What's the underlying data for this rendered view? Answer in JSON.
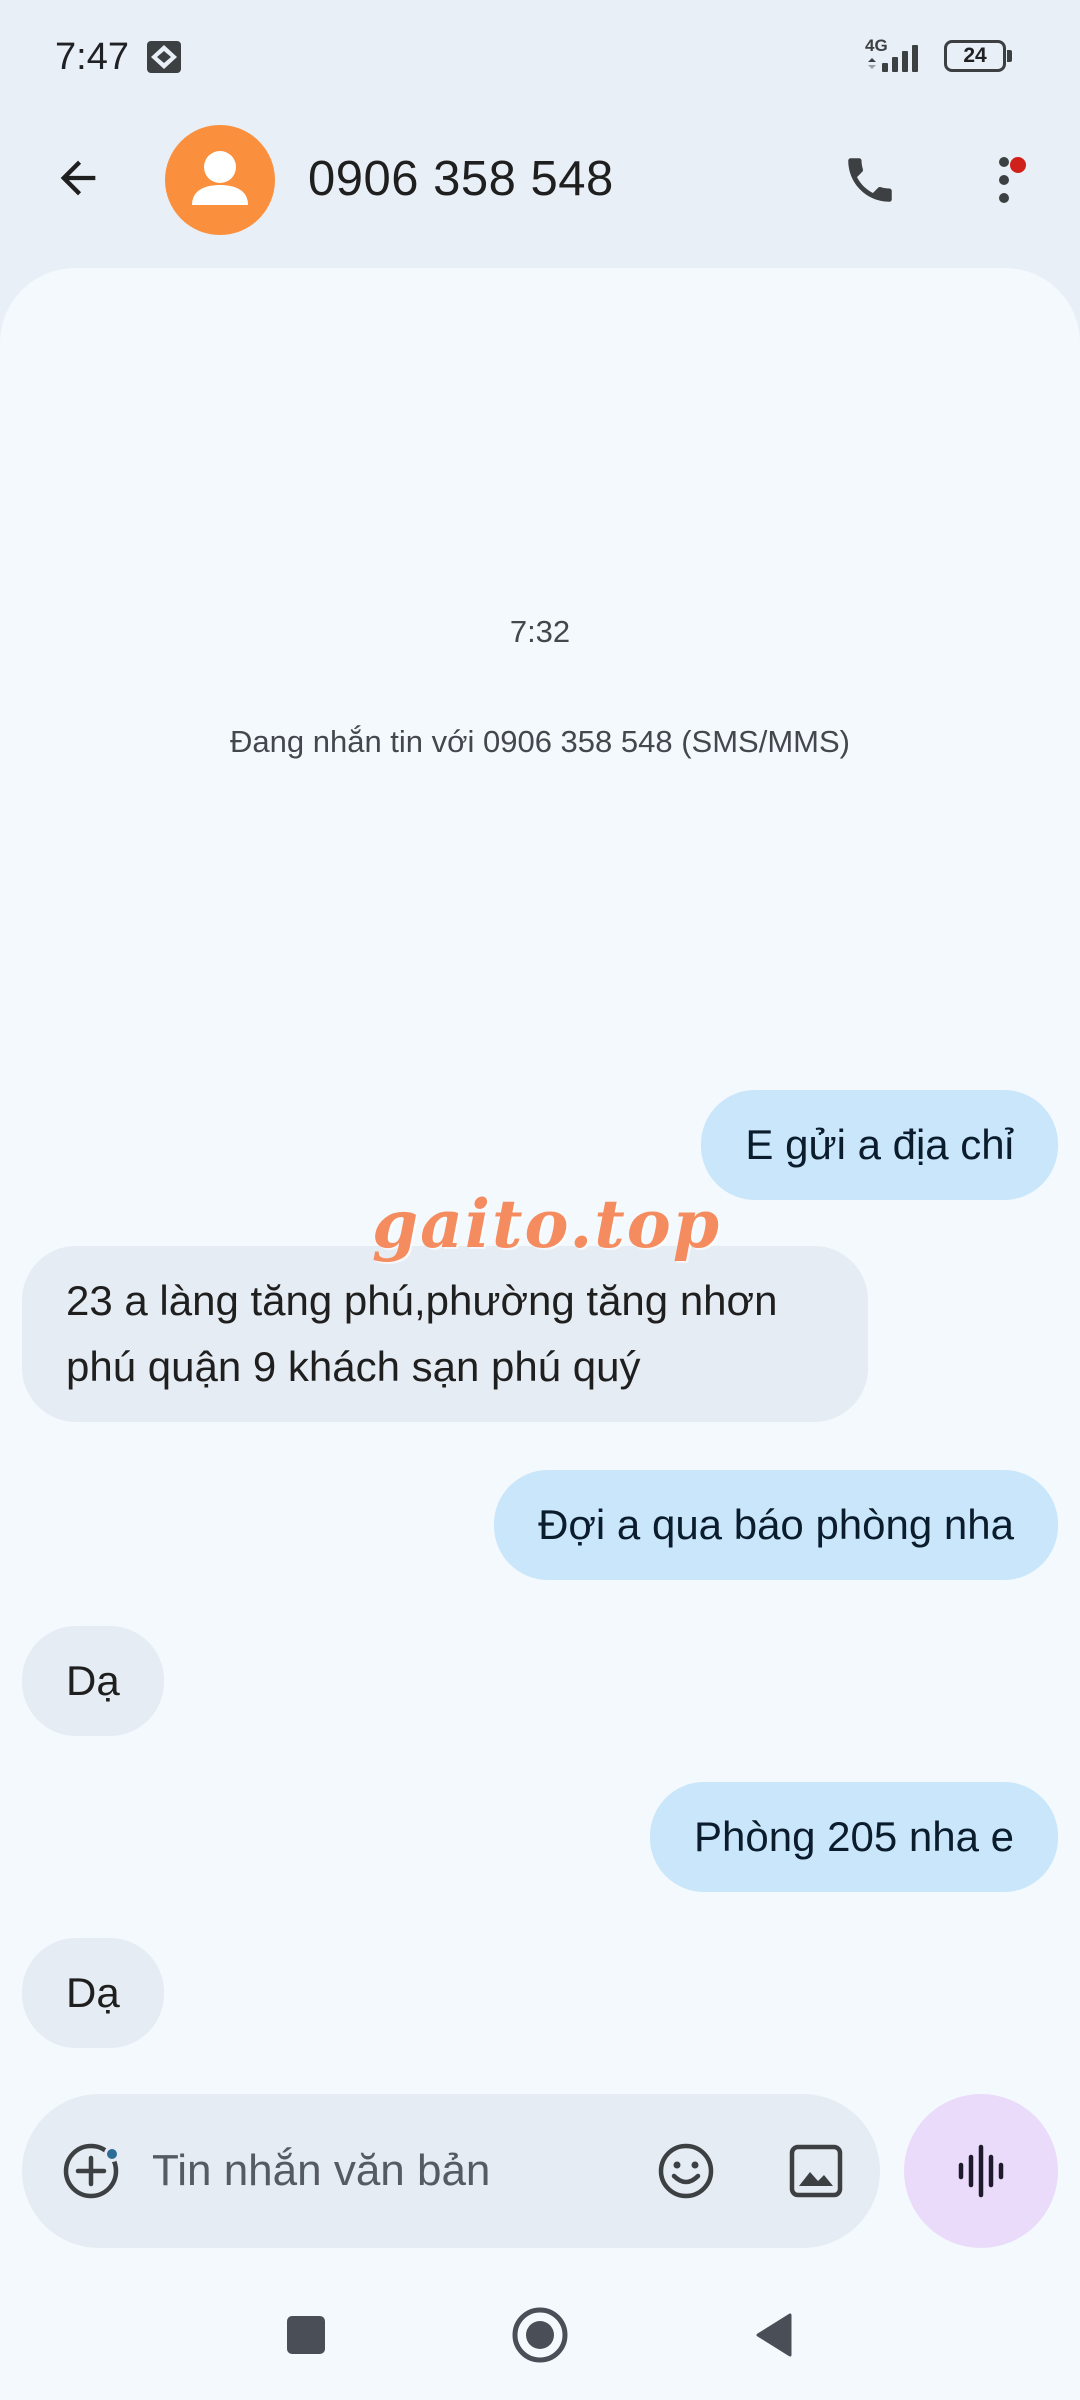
{
  "status_bar": {
    "time": "7:47",
    "network": "4G",
    "battery": "24",
    "app_icon": "gallery-notification-icon"
  },
  "header": {
    "contact": "0906 358 548",
    "back_icon": "arrow-back-icon",
    "avatar_icon": "person-icon",
    "call_icon": "phone-icon",
    "more_icon": "more-vert-icon",
    "avatar_color": "#fa903e",
    "notification_dot_color": "#d0201a"
  },
  "conversation": {
    "timestamp": "7:32",
    "info": "Đang nhắn tin với 0906 358 548 (SMS/MMS)",
    "messages": [
      {
        "direction": "outgoing",
        "text": "E gửi a địa chỉ"
      },
      {
        "direction": "incoming",
        "text": "23 a làng tăng phú,phường tăng nhơn phú quận 9 khách sạn phú quý"
      },
      {
        "direction": "outgoing",
        "text": "Đợi a qua báo phòng nha"
      },
      {
        "direction": "incoming",
        "text": "Dạ"
      },
      {
        "direction": "outgoing",
        "text": "Phòng 205 nha e"
      },
      {
        "direction": "incoming",
        "text": "Dạ"
      }
    ]
  },
  "watermark": "gaito.top",
  "composer": {
    "placeholder": "Tin nhắn văn bản",
    "attach_icon": "add-circle-icon",
    "emoji_icon": "emoji-icon",
    "gallery_icon": "image-icon",
    "voice_icon": "voice-waveform-icon"
  },
  "nav_bar": {
    "recents_icon": "square-recents-icon",
    "home_icon": "circle-home-icon",
    "back_icon": "triangle-back-icon"
  },
  "colors": {
    "outgoing_bubble": "#c9e6fb",
    "incoming_bubble": "#e6ecf3",
    "background": "#f3f9fd",
    "voice_button": "#eadbfa",
    "watermark": "#f58c60"
  }
}
